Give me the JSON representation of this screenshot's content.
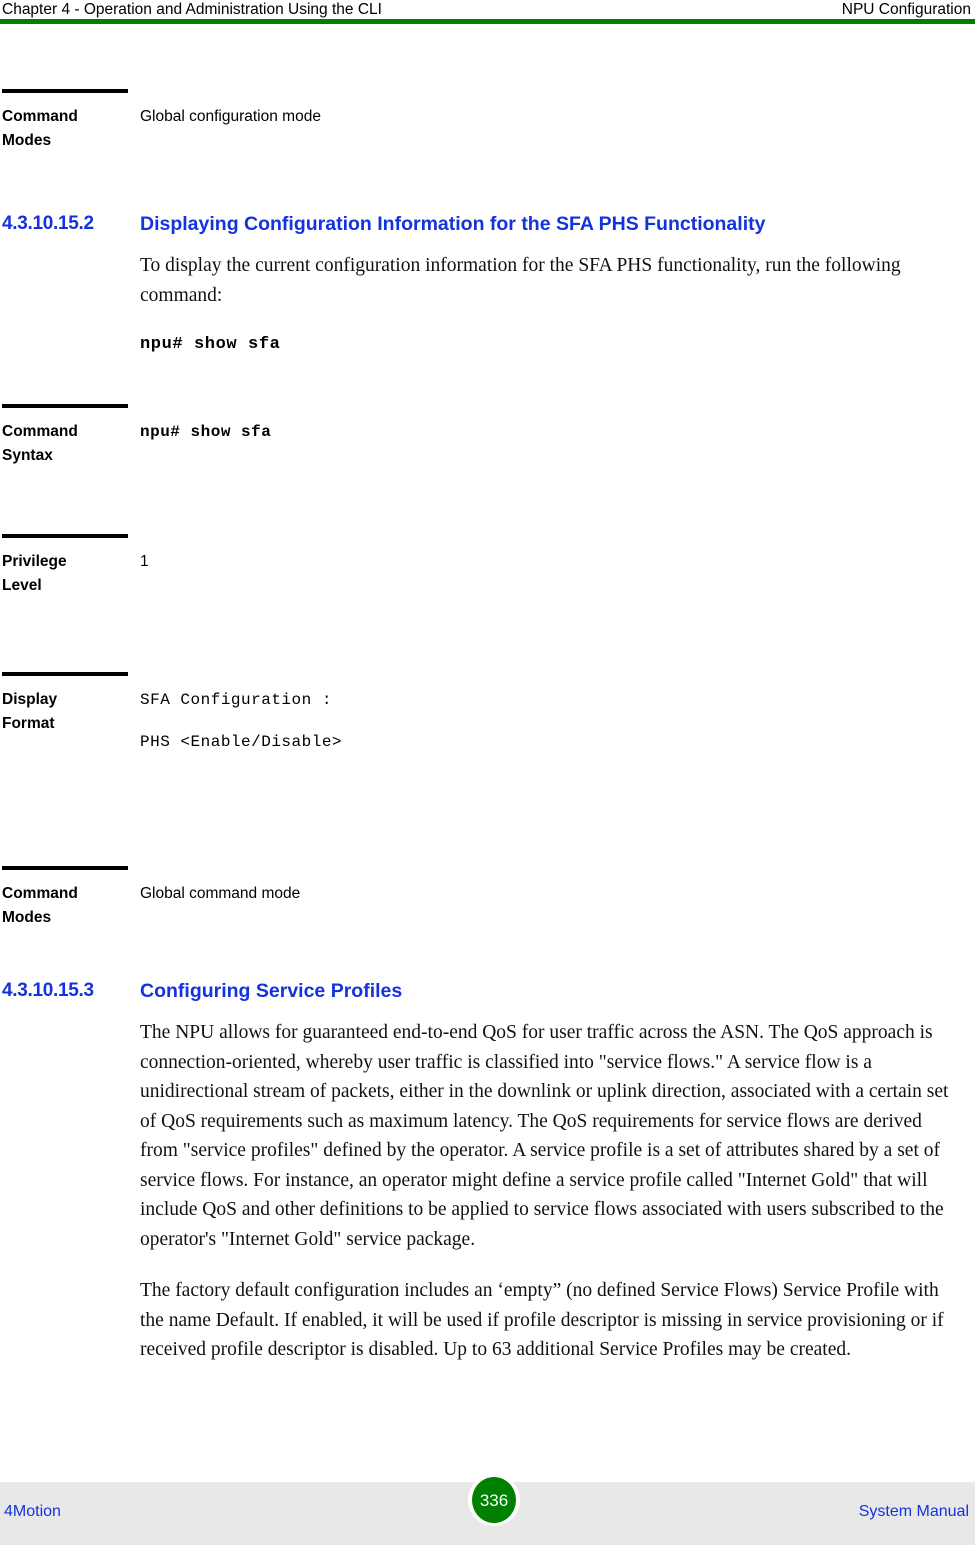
{
  "header": {
    "left": "Chapter 4 - Operation and Administration Using the CLI",
    "right": "NPU Configuration",
    "rule_color": "#008000"
  },
  "accent_colors": {
    "heading_blue": "#1433DE",
    "rule_green": "#008000",
    "footer_band": "#e8e8e8"
  },
  "rows": {
    "command_modes_1": {
      "label_line1": "Command",
      "label_line2": "Modes",
      "value": "Global configuration mode"
    },
    "command_syntax": {
      "label_line1": "Command",
      "label_line2": "Syntax",
      "value": "npu# show sfa"
    },
    "privilege_level": {
      "label_line1": "Privilege",
      "label_line2": "Level",
      "value": "1"
    },
    "display_format": {
      "label_line1": "Display",
      "label_line2": "Format",
      "value_line1": "SFA Configuration :",
      "value_line2": "PHS <Enable/Disable>"
    },
    "command_modes_2": {
      "label_line1": "Command",
      "label_line2": "Modes",
      "value": "Global command mode"
    }
  },
  "sections": [
    {
      "number": "4.3.10.15.2",
      "title": "Displaying Configuration Information for the SFA PHS Functionality",
      "intro": "To display the current configuration information for the SFA PHS functionality, run the following command:",
      "command": "npu# show sfa"
    },
    {
      "number": "4.3.10.15.3",
      "title": "Configuring Service Profiles",
      "paragraph1": "The NPU allows for guaranteed end-to-end QoS for user traffic across the ASN. The QoS approach is connection-oriented, whereby user traffic is classified into \"service flows.\" A service flow is a unidirectional stream of packets, either in the downlink or uplink direction, associated with a certain set of QoS requirements such as maximum latency. The QoS requirements for service flows are derived from \"service profiles\" defined by the operator. A service profile is a set of attributes shared by a set of service flows. For instance, an operator might define a service profile called \"Internet Gold\" that will include QoS and other definitions to be applied to service flows associated with users subscribed to the operator's \"Internet Gold\" service package.",
      "paragraph2": "The factory default configuration includes an ‘empty” (no defined Service Flows) Service Profile with the name Default. If enabled, it will be used if profile descriptor is missing in service provisioning or if received profile descriptor is disabled. Up to 63 additional Service Profiles may be created."
    }
  ],
  "footer": {
    "left": "4Motion",
    "page_number": "336",
    "right": "System Manual"
  }
}
